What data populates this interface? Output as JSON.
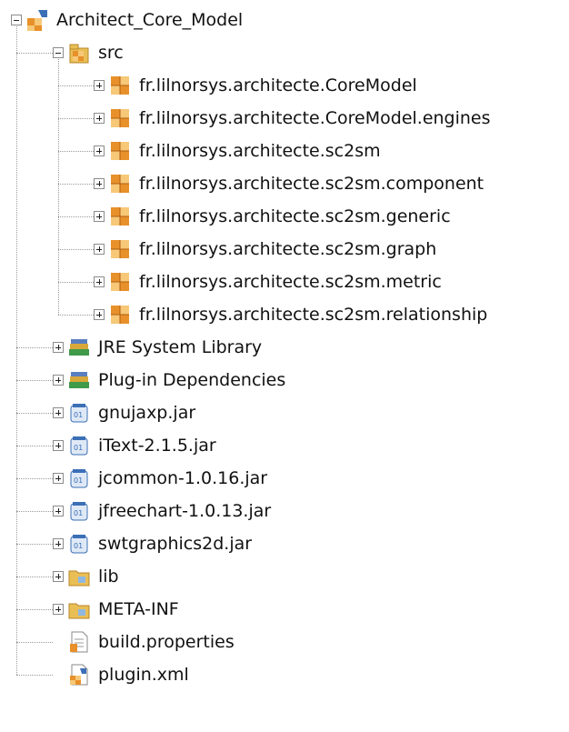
{
  "root": {
    "label": "Architect_Core_Model",
    "icon": "plugin-project-icon",
    "expanded": true
  },
  "src": {
    "label": "src",
    "icon": "source-folder-icon",
    "expanded": true
  },
  "packages": [
    {
      "label": "fr.lilnorsys.architecte.CoreModel",
      "icon": "package-icon"
    },
    {
      "label": "fr.lilnorsys.architecte.CoreModel.engines",
      "icon": "package-icon"
    },
    {
      "label": "fr.lilnorsys.architecte.sc2sm",
      "icon": "package-icon"
    },
    {
      "label": "fr.lilnorsys.architecte.sc2sm.component",
      "icon": "package-icon"
    },
    {
      "label": "fr.lilnorsys.architecte.sc2sm.generic",
      "icon": "package-icon"
    },
    {
      "label": "fr.lilnorsys.architecte.sc2sm.graph",
      "icon": "package-icon"
    },
    {
      "label": "fr.lilnorsys.architecte.sc2sm.metric",
      "icon": "package-icon"
    },
    {
      "label": "fr.lilnorsys.architecte.sc2sm.relationship",
      "icon": "package-icon"
    }
  ],
  "items": [
    {
      "label": "JRE System Library",
      "icon": "library-icon",
      "expandable": true
    },
    {
      "label": "Plug-in Dependencies",
      "icon": "library-icon",
      "expandable": true
    },
    {
      "label": "gnujaxp.jar",
      "icon": "jar-icon",
      "expandable": true
    },
    {
      "label": "iText-2.1.5.jar",
      "icon": "jar-icon",
      "expandable": true
    },
    {
      "label": "jcommon-1.0.16.jar",
      "icon": "jar-icon",
      "expandable": true
    },
    {
      "label": "jfreechart-1.0.13.jar",
      "icon": "jar-icon",
      "expandable": true
    },
    {
      "label": "swtgraphics2d.jar",
      "icon": "jar-icon",
      "expandable": true
    },
    {
      "label": "lib",
      "icon": "folder-icon",
      "expandable": true
    },
    {
      "label": "META-INF",
      "icon": "folder-icon",
      "expandable": true
    },
    {
      "label": "build.properties",
      "icon": "properties-file-icon",
      "expandable": false
    },
    {
      "label": "plugin.xml",
      "icon": "plugin-xml-icon",
      "expandable": false
    }
  ],
  "colors": {
    "package_orange": "#e8902a",
    "package_light": "#f6c878",
    "library_green": "#3f9a4a",
    "jar_blue": "#3b6fb6",
    "folder_yellow": "#e9bf55",
    "tree_line": "#9a9a9a"
  }
}
